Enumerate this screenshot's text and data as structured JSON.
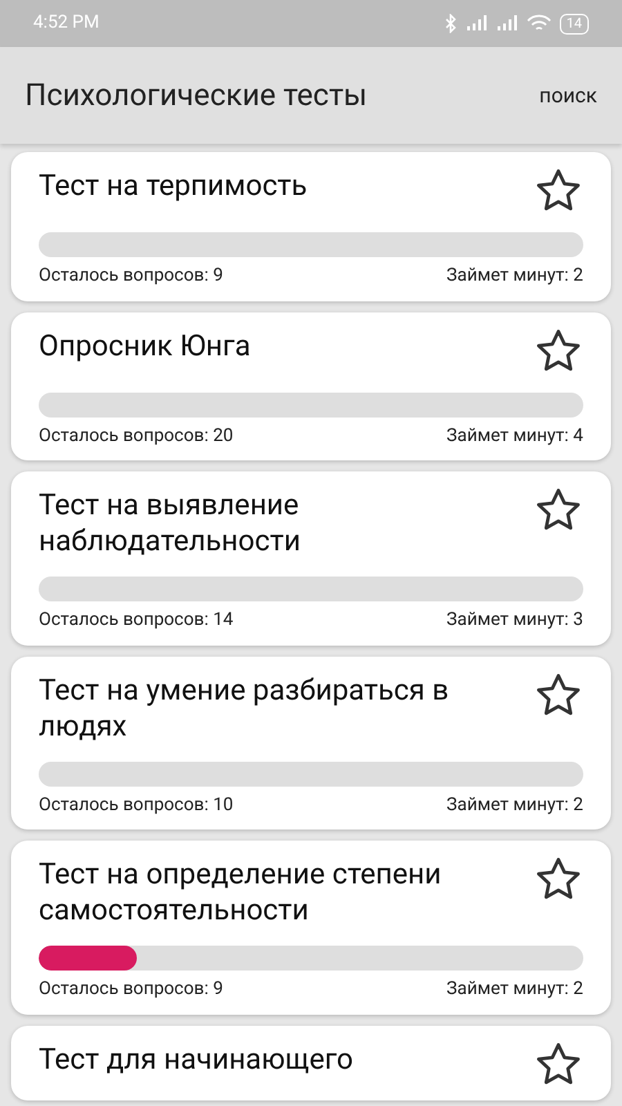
{
  "status_bar": {
    "time": "4:52 PM",
    "battery": "14"
  },
  "app_bar": {
    "title": "Психологические тесты",
    "action": "поиск"
  },
  "tests": [
    {
      "title": "Тест на терпимость",
      "favorite": false,
      "remaining": "Осталось вопросов: 9",
      "duration": "Займет минут: 2"
    },
    {
      "title": "Опросник Юнга",
      "favorite": false,
      "remaining": "Осталось вопросов: 20",
      "duration": "Займет минут: 4"
    },
    {
      "title": "Тест на выявление наблюдательности",
      "favorite": false,
      "remaining": "Осталось вопросов: 14",
      "duration": "Займет минут: 3"
    },
    {
      "title": "Тест на умение разбираться в людях",
      "favorite": false,
      "remaining": "Осталось вопросов: 10",
      "duration": "Займет минут: 2"
    },
    {
      "title": "Тест на определение степени самостоятельности",
      "favorite": false,
      "level": 0.18,
      "remaining": "Осталось вопросов: 9",
      "duration": "Займет минут: 2"
    },
    {
      "title": "Тест для начинающего",
      "favorite": false
    }
  ]
}
